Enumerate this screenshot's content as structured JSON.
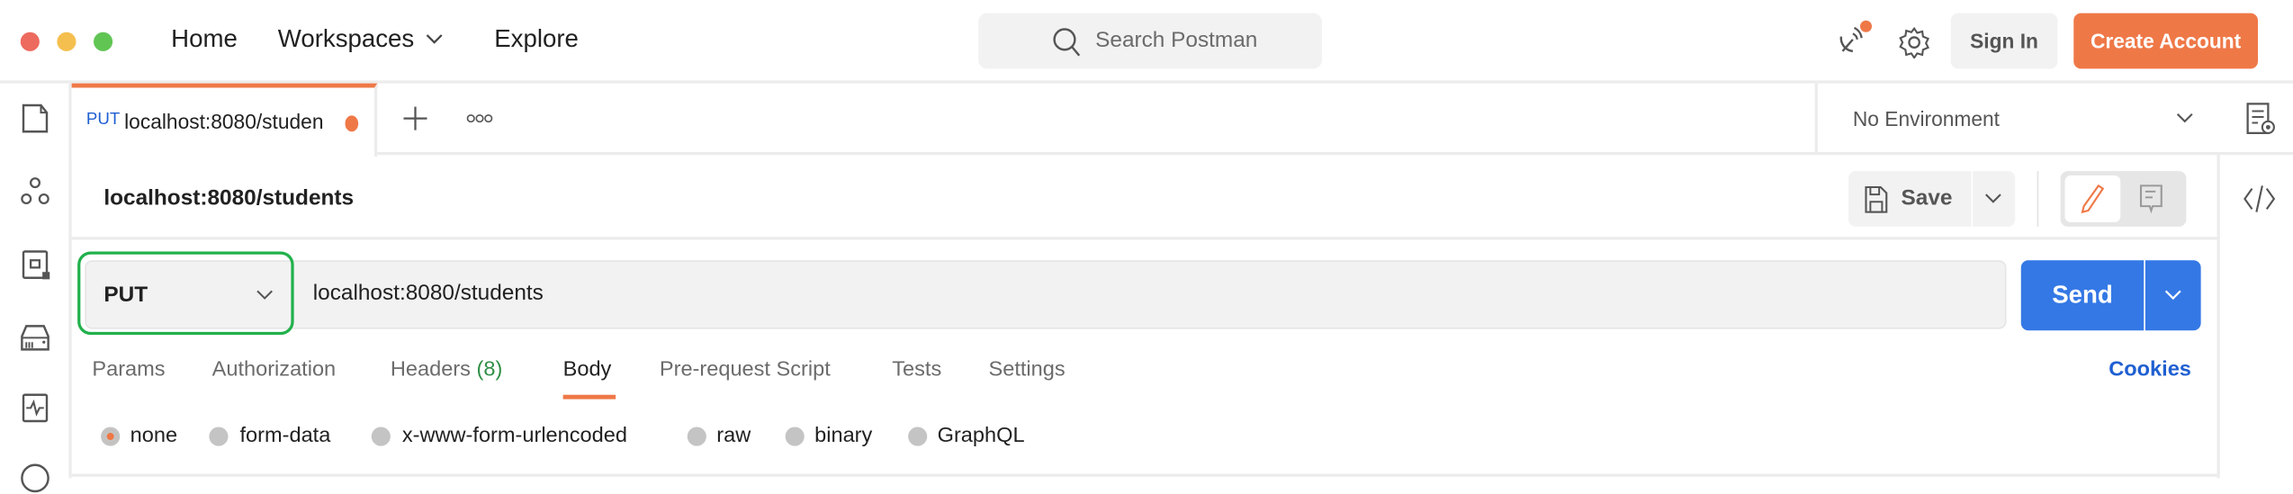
{
  "window": {
    "controls": [
      "close",
      "minimize",
      "zoom"
    ]
  },
  "topnav": {
    "home": "Home",
    "workspaces": "Workspaces",
    "explore": "Explore",
    "search_placeholder": "Search Postman",
    "sign_in": "Sign In",
    "create_account": "Create Account"
  },
  "tabs": {
    "active": {
      "method": "PUT",
      "title": "localhost:8080/studen",
      "unsaved": true
    }
  },
  "environment": {
    "selected": "No Environment"
  },
  "request": {
    "name": "localhost:8080/students",
    "save_label": "Save",
    "method": "PUT",
    "url": "localhost:8080/students",
    "send_label": "Send"
  },
  "request_tabs": {
    "params": "Params",
    "authorization": "Authorization",
    "headers": "Headers",
    "headers_count": "(8)",
    "body": "Body",
    "prerequest": "Pre-request Script",
    "tests": "Tests",
    "settings": "Settings",
    "cookies": "Cookies",
    "active": "Body"
  },
  "body_types": [
    "none",
    "form-data",
    "x-www-form-urlencoded",
    "raw",
    "binary",
    "GraphQL"
  ],
  "body_selected": "none",
  "colors": {
    "accent": "#ef7847",
    "send": "#3478e5",
    "link": "#1f5fd1",
    "highlight": "#22b14c",
    "count": "#2f8f46"
  }
}
